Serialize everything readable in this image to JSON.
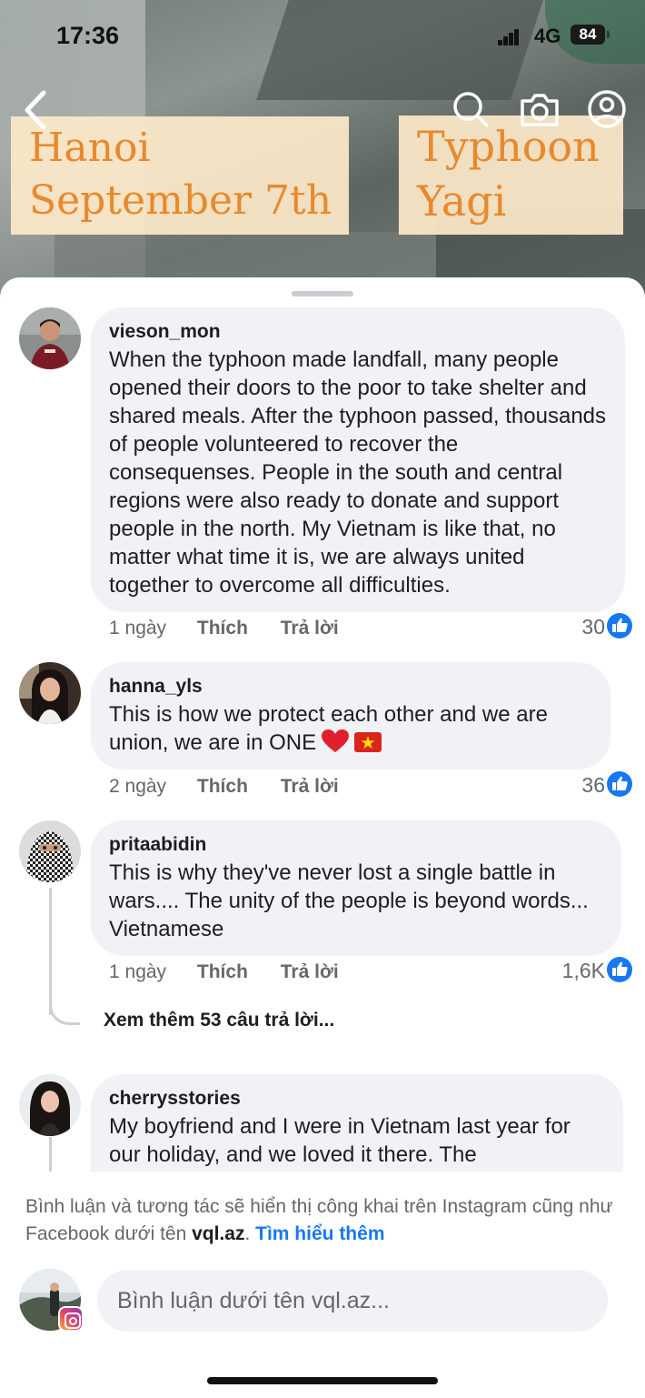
{
  "status_bar": {
    "time": "17:36",
    "network": "4G",
    "battery": "84"
  },
  "video": {
    "overlay_left_line1": "Hanoi",
    "overlay_left_line2": "September 7th",
    "overlay_right_line1": "Typhoon",
    "overlay_right_line2": "Yagi",
    "overlay_text_color": "#e8892c",
    "overlay_bg_color": "#fce8c8"
  },
  "top_icons": [
    "back-icon",
    "search-icon",
    "camera-icon",
    "profile-icon"
  ],
  "comments": [
    {
      "username": "vieson_mon",
      "text": "When the typhoon made landfall, many people opened their doors to the poor to take shelter and shared meals. After the typhoon passed, thousands of people volunteered to recover the consequenses. People in the south and central regions were also ready to donate and support people in the north. My Vietnam is like that, no matter what time it is, we are always united together to overcome all difficulties.",
      "time": "1 ngày",
      "like_label": "Thích",
      "reply_label": "Trả lời",
      "likes": "30"
    },
    {
      "username": "hanna_yls",
      "text": "This is how we protect each other and we are union, we are in ONE",
      "emojis": [
        "heart",
        "vietnam-flag"
      ],
      "time": "2 ngày",
      "like_label": "Thích",
      "reply_label": "Trả lời",
      "likes": "36"
    },
    {
      "username": "pritaabidin",
      "text": "This is why they've never lost a single battle in wars.... The unity of the people is beyond words... Vietnamese",
      "time": "1 ngày",
      "like_label": "Thích",
      "reply_label": "Trả lời",
      "likes": "1,6K",
      "more_replies": "Xem thêm 53 câu trả lời..."
    },
    {
      "username": "cherrysstories",
      "text": "My boyfriend and I were in Vietnam last year for our holiday, and we loved it there. The"
    }
  ],
  "footer": {
    "notice_text": "Bình luận và tương tác sẽ hiển thị công khai trên Instagram cũng như Facebook dưới tên ",
    "notice_name": "vql.az",
    "notice_sep": ".",
    "learn_more": "Tìm hiểu thêm",
    "input_placeholder": "Bình luận dưới tên vql.az..."
  },
  "colors": {
    "bubble_bg": "#f0f2f5",
    "link_blue": "#1877f2",
    "secondary_text": "#65676b"
  }
}
